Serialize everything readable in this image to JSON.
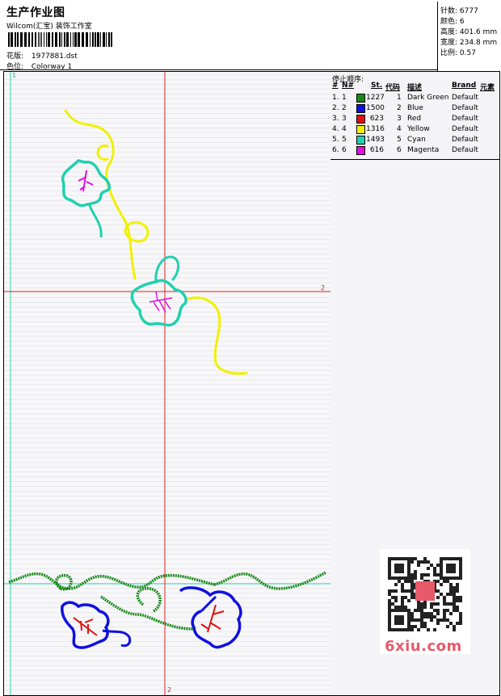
{
  "header": {
    "title": "生产作业图",
    "studio": "Wilcom(汇宝) 装饰工作室",
    "design_label": "花版:",
    "design_value": "1977881.dst",
    "colorway_label": "色位:",
    "colorway_value": "Colorway 1"
  },
  "stats": [
    {
      "label": "针数:",
      "value": "6777"
    },
    {
      "label": "颜色:",
      "value": "6"
    },
    {
      "label": "高度:",
      "value": "401.6 mm"
    },
    {
      "label": "宽度:",
      "value": "234.8 mm"
    },
    {
      "label": "比例:",
      "value": "0.57"
    }
  ],
  "stop_sequence": {
    "title": "停止顺序:",
    "headers": {
      "num": "#",
      "n": "N#",
      "stitches": "St.",
      "code": "代码",
      "desc": "描述",
      "brand": "Brand",
      "elements": "元素"
    },
    "rows": [
      {
        "num": "1.",
        "n": "1",
        "color": "#1a8a1a",
        "stitches": "1227",
        "code": "1",
        "desc": "Dark Green",
        "brand": "Default"
      },
      {
        "num": "2.",
        "n": "2",
        "color": "#1010e0",
        "stitches": "1500",
        "code": "2",
        "desc": "Blue",
        "brand": "Default"
      },
      {
        "num": "3.",
        "n": "3",
        "color": "#e01010",
        "stitches": "623",
        "code": "3",
        "desc": "Red",
        "brand": "Default"
      },
      {
        "num": "4.",
        "n": "4",
        "color": "#f0f000",
        "stitches": "1316",
        "code": "4",
        "desc": "Yellow",
        "brand": "Default"
      },
      {
        "num": "5.",
        "n": "5",
        "color": "#20d0b0",
        "stitches": "1493",
        "code": "5",
        "desc": "Cyan",
        "brand": "Default"
      },
      {
        "num": "6.",
        "n": "6",
        "color": "#e010e0",
        "stitches": "616",
        "code": "6",
        "desc": "Magenta",
        "brand": "Default"
      }
    ]
  },
  "axis_labels": {
    "top_marker": "1",
    "right_marker": "2",
    "bottom_marker": "2"
  },
  "watermark": "6xiu.com"
}
